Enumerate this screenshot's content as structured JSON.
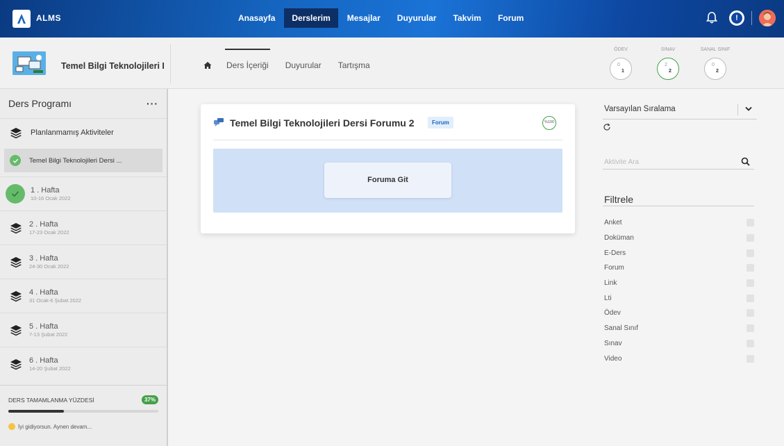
{
  "topbar": {
    "brand": "ALMS",
    "nav": [
      {
        "label": "Anasayfa",
        "active": false
      },
      {
        "label": "Derslerim",
        "active": true
      },
      {
        "label": "Mesajlar",
        "active": false
      },
      {
        "label": "Duyurular",
        "active": false
      },
      {
        "label": "Takvim",
        "active": false
      },
      {
        "label": "Forum",
        "active": false
      }
    ],
    "icons": [
      "bell-icon",
      "alert-icon",
      "avatar"
    ]
  },
  "course": {
    "title": "Temel Bilgi Teknolojileri I",
    "tabs": [
      "Ders İçeriği",
      "Duyurular",
      "Tartışma"
    ],
    "active_tab": "Ders İçeriği",
    "stats": [
      {
        "label": "ÖDEV",
        "top": "0",
        "bottom": "1",
        "complete": false
      },
      {
        "label": "SINAV",
        "top": "2",
        "bottom": "2",
        "complete": true
      },
      {
        "label": "SANAL SINIF",
        "top": "0",
        "bottom": "2",
        "complete": false
      }
    ]
  },
  "sidebar": {
    "title": "Ders Programı",
    "menu": "···",
    "unplanned": "Planlanmamış Aktiviteler",
    "selected_activity": "Temel Bilgi Teknolojileri Dersi ...",
    "weeks": [
      {
        "title": "1 . Hafta",
        "date": "10-16 Ocak 2022",
        "complete": true
      },
      {
        "title": "2 . Hafta",
        "date": "17-23 Ocak 2022",
        "complete": false
      },
      {
        "title": "3 . Hafta",
        "date": "24-30 Ocak 2022",
        "complete": false
      },
      {
        "title": "4 . Hafta",
        "date": "31 Ocak-6 Şubat 2022",
        "complete": false
      },
      {
        "title": "5 . Hafta",
        "date": "7-13 Şubat 2022",
        "complete": false
      },
      {
        "title": "6 . Hafta",
        "date": "14-20 Şubat 2022",
        "complete": false
      }
    ],
    "completion": {
      "label": "DERS TAMAMLANMA YÜZDESİ",
      "percent_text": "37%",
      "percent": 37,
      "message": "İyi gidiyorsun. Aynen devam..."
    }
  },
  "card": {
    "title": "Temel Bilgi Teknolojileri Dersi Forumu 2",
    "badge": "Forum",
    "progress": "%100",
    "button": "Foruma Git"
  },
  "right": {
    "sort_value": "Varsayılan Sıralama",
    "search_placeholder": "Aktivite Ara",
    "filters_title": "Filtrele",
    "filters": [
      "Anket",
      "Doküman",
      "E-Ders",
      "Forum",
      "Link",
      "Lti",
      "Ödev",
      "Sanal Sınıf",
      "Sınav",
      "Video"
    ]
  },
  "colors": {
    "accent": "#1565c0",
    "success": "#43a047",
    "nav_active": "#0d2f66"
  }
}
